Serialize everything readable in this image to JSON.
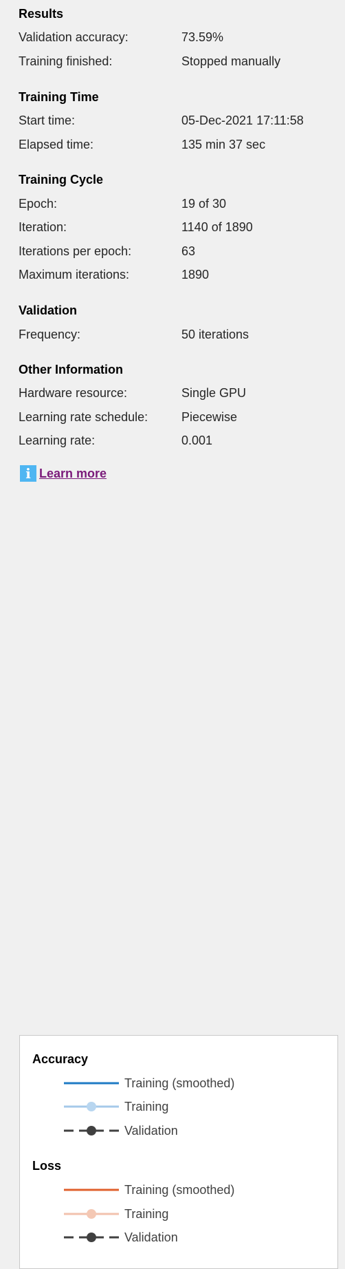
{
  "results": {
    "title": "Results",
    "rows": [
      {
        "label": "Validation accuracy:",
        "value": "73.59%"
      },
      {
        "label": "Training finished:",
        "value": "Stopped manually"
      }
    ]
  },
  "training_time": {
    "title": "Training Time",
    "rows": [
      {
        "label": "Start time:",
        "value": "05-Dec-2021 17:11:58"
      },
      {
        "label": "Elapsed time:",
        "value": "135 min 37 sec"
      }
    ]
  },
  "training_cycle": {
    "title": "Training Cycle",
    "rows": [
      {
        "label": "Epoch:",
        "value": "19 of 30"
      },
      {
        "label": "Iteration:",
        "value": "1140 of 1890"
      },
      {
        "label": "Iterations per epoch:",
        "value": "63"
      },
      {
        "label": "Maximum iterations:",
        "value": "1890"
      }
    ]
  },
  "validation": {
    "title": "Validation",
    "rows": [
      {
        "label": "Frequency:",
        "value": "50 iterations"
      }
    ]
  },
  "other_information": {
    "title": "Other Information",
    "rows": [
      {
        "label": "Hardware resource:",
        "value": "Single GPU"
      },
      {
        "label": "Learning rate schedule:",
        "value": "Piecewise"
      },
      {
        "label": "Learning rate:",
        "value": "0.001"
      }
    ]
  },
  "learn_more": {
    "label": "Learn more",
    "icon": "info-icon"
  },
  "legend": {
    "accuracy": {
      "title": "Accuracy",
      "items": [
        {
          "label": "Training (smoothed)",
          "color": "#1f7bc4"
        },
        {
          "label": "Training",
          "color": "#a5c9ea"
        },
        {
          "label": "Validation",
          "color": "#404040"
        }
      ]
    },
    "loss": {
      "title": "Loss",
      "items": [
        {
          "label": "Training (smoothed)",
          "color": "#e0602c"
        },
        {
          "label": "Training",
          "color": "#f2c2ad"
        },
        {
          "label": "Validation",
          "color": "#404040"
        }
      ]
    }
  }
}
